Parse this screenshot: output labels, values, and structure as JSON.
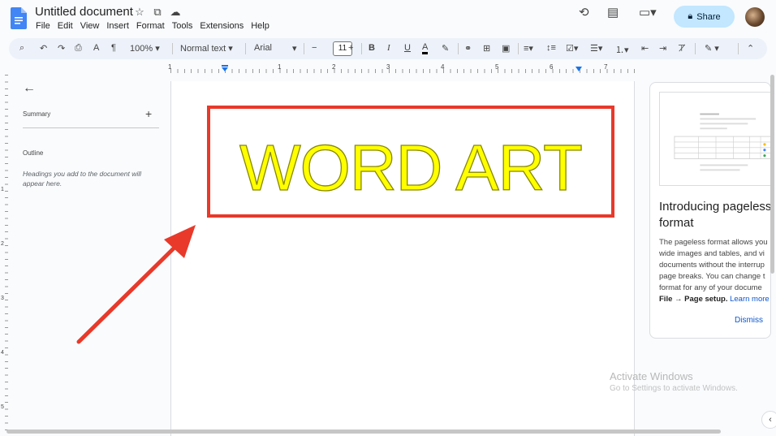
{
  "document": {
    "title": "Untitled document",
    "menu": [
      "File",
      "Edit",
      "View",
      "Insert",
      "Format",
      "Tools",
      "Extensions",
      "Help"
    ]
  },
  "header": {
    "share_label": "Share"
  },
  "toolbar": {
    "zoom": "100%",
    "style": "Normal text",
    "font": "Arial",
    "font_size": "11"
  },
  "ruler": {
    "numbers": [
      "1",
      "1",
      "2",
      "3",
      "4",
      "5",
      "6",
      "7"
    ],
    "vnumbers": [
      "1",
      "2",
      "3",
      "4",
      "5"
    ]
  },
  "sidebar": {
    "summary_label": "Summary",
    "outline_label": "Outline",
    "outline_help": "Headings you add to the document will appear here."
  },
  "page": {
    "wordart_text": "WORD ART"
  },
  "card": {
    "title_line1": "Introducing pageless",
    "title_line2": "format",
    "body_lines": [
      "The pageless format allows you",
      "wide images and tables, and vi",
      "documents without the interrup",
      "page breaks. You can change t",
      "format for any of your docume"
    ],
    "body_last_bold": "File → Page setup.",
    "learn_more": "Learn more",
    "dismiss": "Dismiss"
  },
  "watermark": {
    "line1": "Activate Windows",
    "line2": "Go to Settings to activate Windows."
  },
  "colors": {
    "wordart_fill": "#ffff00",
    "wordart_stroke": "#888800",
    "box_border": "#e8392a",
    "arrow": "#e8392a",
    "share_bg": "#c2e7ff"
  }
}
